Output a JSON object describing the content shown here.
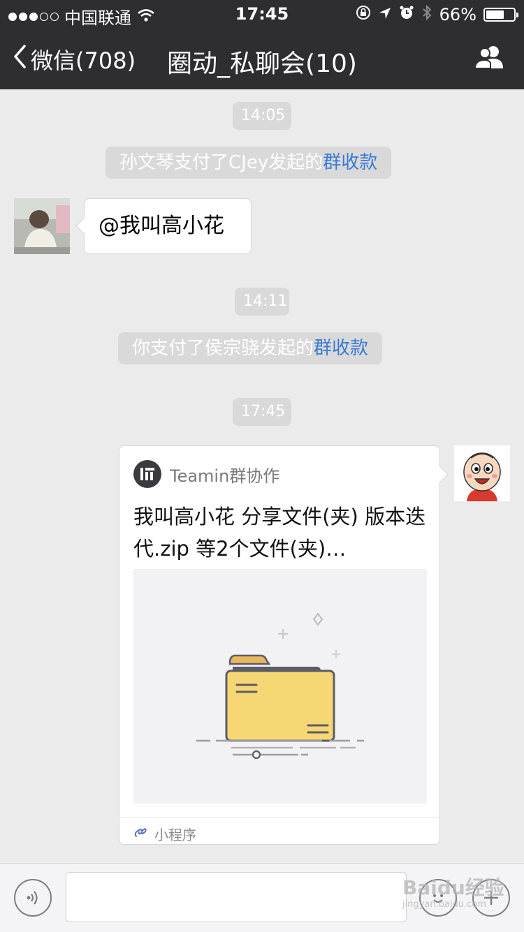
{
  "status_bar": {
    "carrier": "中国联通",
    "time": "17:45",
    "battery_percent": "66%",
    "battery_level": 0.66,
    "signal_bars_filled": 3,
    "signal_bars_total": 5,
    "icons": [
      "wifi-icon",
      "rotation-lock-icon",
      "location-icon",
      "alarm-icon",
      "bluetooth-icon",
      "battery-icon"
    ]
  },
  "nav": {
    "back_label": "微信(708)",
    "title": "圈动_私聊会(10)",
    "right_icon": "group-members-icon"
  },
  "messages": [
    {
      "type": "time",
      "text": "14:05"
    },
    {
      "type": "system",
      "text": "孙文琴支付了CJey发起的",
      "link": "群收款"
    },
    {
      "type": "text",
      "side": "left",
      "text": "@我叫高小花"
    },
    {
      "type": "time",
      "text": "14:11"
    },
    {
      "type": "system",
      "text": "你支付了侯宗骁发起的",
      "link": "群收款"
    },
    {
      "type": "time",
      "text": "17:45"
    },
    {
      "type": "mini_program_card",
      "side": "right",
      "app_name": "Teamin群协作",
      "title": "我叫高小花 分享文件(夹) 版本迭代.zip 等2个文件(夹)…",
      "footer": "小程序"
    }
  ],
  "input_bar": {
    "value": "",
    "left_icon": "voice-icon",
    "right_icons": [
      "emoji-icon",
      "plus-icon"
    ]
  },
  "watermark": {
    "text": "Baidu经验",
    "sub": "jingyan.baidu.com"
  },
  "colors": {
    "nav_bg": "#2e2e31",
    "chat_bg": "#ebebeb",
    "link": "#3a7bd5",
    "pill_bg": "#d9d9d9",
    "folder": "#f7d774"
  }
}
